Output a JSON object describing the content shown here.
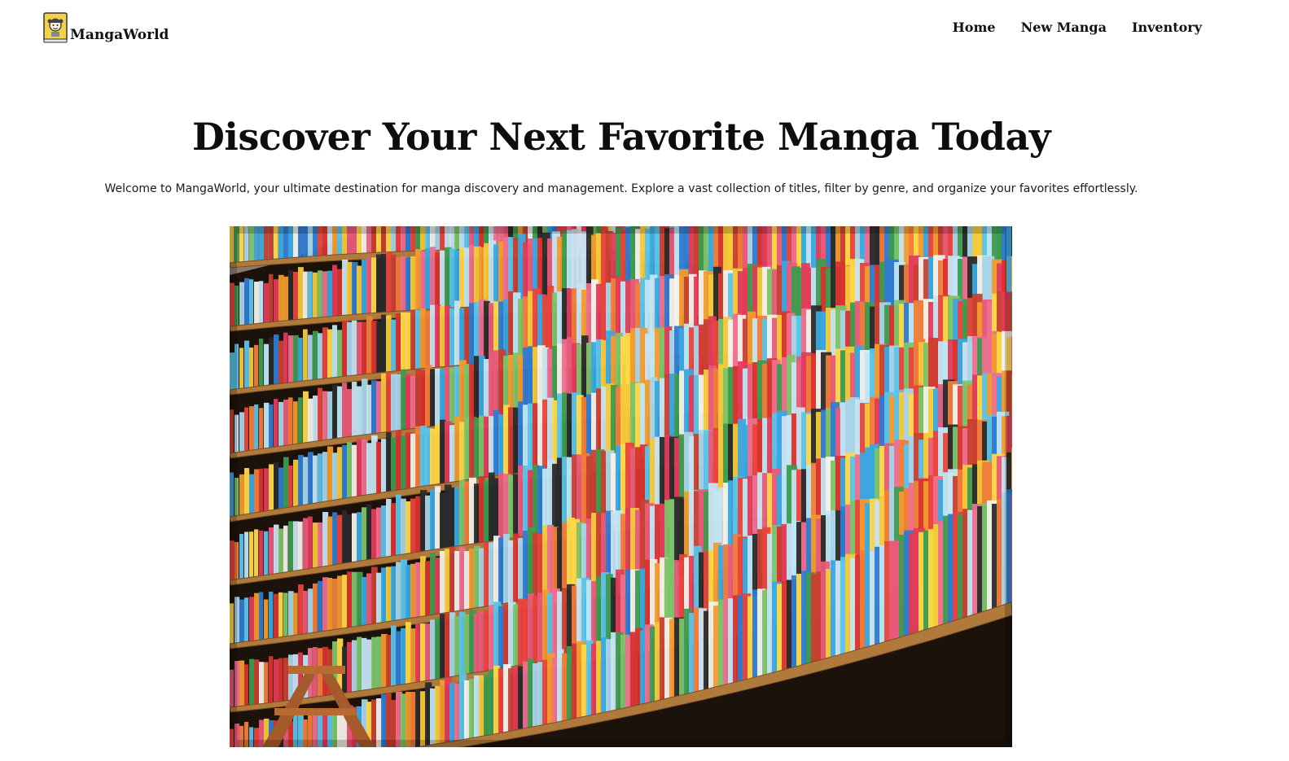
{
  "header": {
    "brand": {
      "name": "MangaWorld",
      "logo_icon": "manga-reader-logo-icon"
    },
    "nav": [
      {
        "label": "Home"
      },
      {
        "label": "New Manga"
      },
      {
        "label": "Inventory"
      }
    ]
  },
  "hero": {
    "title": "Discover Your Next Favorite Manga Today",
    "description": "Welcome to MangaWorld, your ultimate destination for manga discovery and management. Explore a vast collection of titles, filter by genre, and organize your favorites effortlessly.",
    "image": {
      "icon": "library-bookshelves-photo"
    }
  },
  "colors": {
    "background": "#ffffff",
    "text": "#111111",
    "logo_yellow": "#f5d547",
    "shelf_wood": "#b07a3c"
  }
}
